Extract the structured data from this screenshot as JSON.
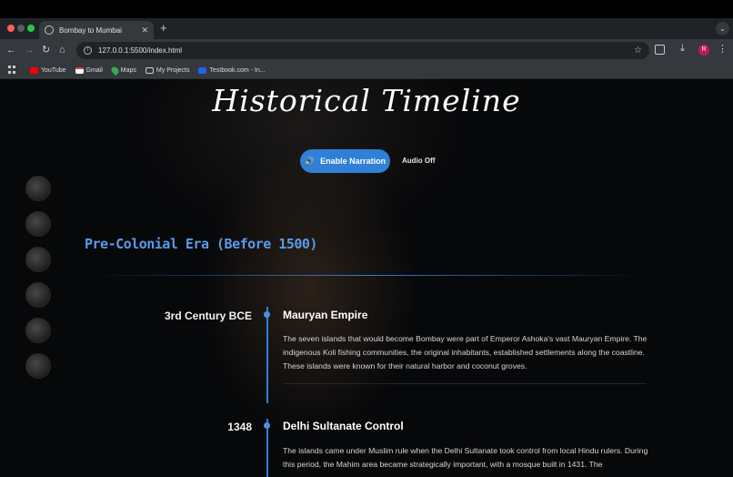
{
  "browser": {
    "tab_title": "Bombay to Mumbai",
    "tab_close": "✕",
    "new_tab": "+",
    "tab_menu": "⌄",
    "url": "127.0.0.1:5500/index.html",
    "avatar_letter": "R",
    "bookmarks": [
      {
        "label": "YouTube",
        "icon": "youtube-icon"
      },
      {
        "label": "Gmail",
        "icon": "gmail-icon"
      },
      {
        "label": "Maps",
        "icon": "maps-icon"
      },
      {
        "label": "My Projects",
        "icon": "folder-icon"
      },
      {
        "label": "Testbook.com - In...",
        "icon": "testbook-icon"
      }
    ]
  },
  "page": {
    "title": "Historical Timeline",
    "narration_button": "Enable Narration",
    "narration_icon": "🔊",
    "audio_status": "Audio Off",
    "era_title": "Pre-Colonial Era (Before 1500)",
    "accent_color": "#2f80d6",
    "events": [
      {
        "date": "3rd Century BCE",
        "title": "Mauryan Empire",
        "description": "The seven islands that would become Bombay were part of Emperor Ashoka's vast Mauryan Empire. The indigenous Koli fishing communities, the original inhabitants, established settlements along the coastline. These islands were known for their natural harbor and coconut groves."
      },
      {
        "date": "1348",
        "title": "Delhi Sultanate Control",
        "description": "The islands came under Muslim rule when the Delhi Sultanate took control from local Hindu rulers. During this period, the Mahim area became strategically important, with a mosque built in 1431. The"
      }
    ]
  }
}
